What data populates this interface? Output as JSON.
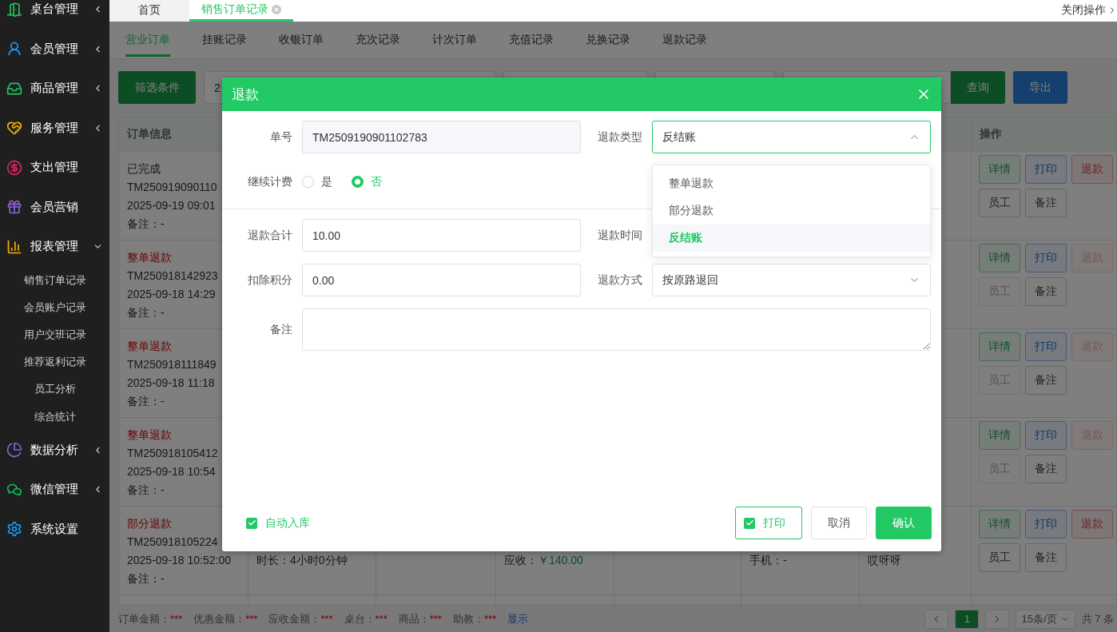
{
  "sidebar": {
    "items": [
      {
        "label": "桌台管理",
        "expanded": false
      },
      {
        "label": "会员管理",
        "expanded": false
      },
      {
        "label": "商品管理",
        "expanded": false
      },
      {
        "label": "服务管理",
        "expanded": false
      },
      {
        "label": "支出管理"
      },
      {
        "label": "会员营销"
      },
      {
        "label": "报表管理",
        "expanded": true,
        "children": [
          {
            "label": "销售订单记录"
          },
          {
            "label": "会员账户记录"
          },
          {
            "label": "用户交班记录"
          },
          {
            "label": "推荐返利记录"
          },
          {
            "label": "员工分析"
          },
          {
            "label": "综合统计"
          }
        ]
      },
      {
        "label": "数据分析",
        "expanded": false
      },
      {
        "label": "微信管理",
        "expanded": false
      },
      {
        "label": "系统设置"
      }
    ]
  },
  "page_tabs": {
    "tabs": [
      {
        "label": "首页",
        "selected": false,
        "closable": false
      },
      {
        "label": "销售订单记录",
        "selected": true,
        "closable": true
      }
    ],
    "close_ops": "关闭操作"
  },
  "sub_tabs": [
    {
      "label": "营业订单",
      "selected": true
    },
    {
      "label": "挂账记录",
      "selected": false
    },
    {
      "label": "收银订单",
      "selected": false
    },
    {
      "label": "充次记录",
      "selected": false
    },
    {
      "label": "计次订单",
      "selected": false
    },
    {
      "label": "充值记录",
      "selected": false
    },
    {
      "label": "兑换记录",
      "selected": false
    },
    {
      "label": "退款记录",
      "selected": false
    }
  ],
  "toolbar": {
    "filter_button": "筛选条件",
    "date_field": "2",
    "search_button": "查询",
    "export_button": "导出"
  },
  "table": {
    "columns": {
      "first": "订单信息",
      "last": "操作"
    },
    "rows": [
      {
        "status": "已完成",
        "kind": "done",
        "order_no": "TM250919090110",
        "time": "2025-09-19 09:01",
        "note": "备注：-",
        "actions": [
          {
            "label": "详情",
            "kind": "detail",
            "disabled": false
          },
          {
            "label": "打印",
            "kind": "print",
            "disabled": false
          },
          {
            "label": "退款",
            "kind": "refund",
            "disabled": false
          },
          {
            "label": "员工",
            "kind": "staff",
            "disabled": false
          },
          {
            "label": "备注",
            "kind": "note",
            "disabled": false
          }
        ]
      },
      {
        "status": "整单退款",
        "kind": "refund",
        "order_no": "TM250918142923",
        "time": "2025-09-18 14:29",
        "note": "备注：-",
        "actions": [
          {
            "label": "详情",
            "kind": "detail",
            "disabled": false
          },
          {
            "label": "打印",
            "kind": "print",
            "disabled": false
          },
          {
            "label": "退款",
            "kind": "refund",
            "disabled": true
          },
          {
            "label": "员工",
            "kind": "staff",
            "disabled": true
          },
          {
            "label": "备注",
            "kind": "note",
            "disabled": false
          }
        ]
      },
      {
        "status": "整单退款",
        "kind": "refund",
        "order_no": "TM250918111849",
        "time": "2025-09-18 11:18",
        "note": "备注：-",
        "actions": [
          {
            "label": "详情",
            "kind": "detail",
            "disabled": false
          },
          {
            "label": "打印",
            "kind": "print",
            "disabled": false
          },
          {
            "label": "退款",
            "kind": "refund",
            "disabled": true
          },
          {
            "label": "员工",
            "kind": "staff",
            "disabled": true
          },
          {
            "label": "备注",
            "kind": "note",
            "disabled": false
          }
        ]
      },
      {
        "status": "整单退款",
        "kind": "refund",
        "order_no": "TM250918105412",
        "time": "2025-09-18 10:54",
        "note": "备注：-",
        "actions": [
          {
            "label": "详情",
            "kind": "detail",
            "disabled": false
          },
          {
            "label": "打印",
            "kind": "print",
            "disabled": false
          },
          {
            "label": "退款",
            "kind": "refund",
            "disabled": true
          },
          {
            "label": "员工",
            "kind": "staff",
            "disabled": true
          },
          {
            "label": "备注",
            "kind": "note",
            "disabled": false
          }
        ]
      },
      {
        "status": "部分退款",
        "kind": "refund",
        "order_no": "TM250918105224",
        "time": "2025-09-18 10:52:00",
        "note": "备注：-",
        "duration": "时长：4小时0分钟",
        "receivable_label": "应收：",
        "receivable": "￥140.00",
        "phone": "手机：-",
        "column_7": "哎呀呀",
        "actions": [
          {
            "label": "详情",
            "kind": "detail",
            "disabled": false
          },
          {
            "label": "打印",
            "kind": "print",
            "disabled": false
          },
          {
            "label": "退款",
            "kind": "refund",
            "disabled": false
          },
          {
            "label": "员工",
            "kind": "staff",
            "disabled": false
          },
          {
            "label": "备注",
            "kind": "note",
            "disabled": false
          }
        ]
      }
    ]
  },
  "summary": [
    {
      "label": "订单金额：",
      "value": "***"
    },
    {
      "label": "优惠金额：",
      "value": "***"
    },
    {
      "label": "应收金额：",
      "value": "***"
    },
    {
      "label": "桌台：",
      "value": "***"
    },
    {
      "label": "商品：",
      "value": "***"
    },
    {
      "label": "助教：",
      "value": "***"
    }
  ],
  "show_link": "显示",
  "pagination": {
    "pages": [
      {
        "label": "1",
        "selected": true
      }
    ],
    "page_size": "15条/页",
    "total": "共 7 条"
  },
  "dialog": {
    "title": "退款",
    "order_no": {
      "label": "单号",
      "value": "TM2509190901102783"
    },
    "refund_type": {
      "label": "退款类型",
      "value": "反结账",
      "open": true,
      "options": [
        {
          "label": "整单退款",
          "selected": false
        },
        {
          "label": "部分退款",
          "selected": false
        },
        {
          "label": "反结账",
          "selected": true
        }
      ]
    },
    "continue_billing": {
      "label": "继续计费",
      "options": [
        {
          "label": "是",
          "selected": false
        },
        {
          "label": "否",
          "selected": true
        }
      ]
    },
    "refund_total": {
      "label": "退款合计",
      "value": "10.00"
    },
    "refund_time": {
      "label": "退款时间"
    },
    "deduct_points": {
      "label": "扣除积分",
      "value": "0.00"
    },
    "refund_method": {
      "label": "退款方式",
      "value": "按原路退回"
    },
    "remark": {
      "label": "备注"
    },
    "auto_stock": {
      "label": "自动入库",
      "checked": true
    },
    "print": {
      "label": "打印",
      "checked": true
    },
    "cancel_button": "取消",
    "confirm_button": "确认"
  }
}
